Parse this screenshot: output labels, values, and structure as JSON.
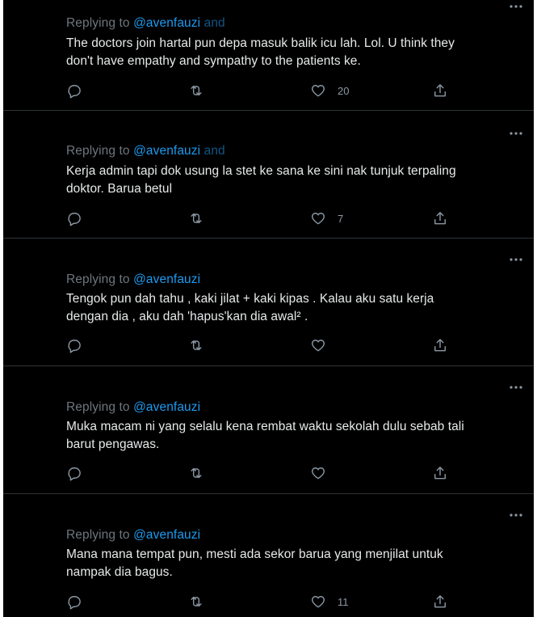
{
  "replying_prefix": "Replying to",
  "tweets": [
    {
      "reply_to": "@avenfauzi",
      "reply_to_suffix": "and",
      "text_lines": [
        "The doctors join hartal pun depa masuk balik icu lah. Lol. U think they",
        "don't have empathy and sympathy to the patients ke."
      ],
      "likes": "20"
    },
    {
      "reply_to": "@avenfauzi",
      "reply_to_suffix": "and",
      "text_lines": [
        "Kerja admin tapi dok usung la stet ke sana ke sini nak tunjuk terpaling",
        "doktor. Barua betul"
      ],
      "likes": "7"
    },
    {
      "reply_to": "@avenfauzi",
      "reply_to_suffix": "",
      "text_lines": [
        "Tengok pun dah tahu , kaki jilat + kaki kipas . Kalau aku satu kerja",
        "dengan dia , aku dah 'hapus'kan dia awal² ."
      ],
      "likes": ""
    },
    {
      "reply_to": "@avenfauzi",
      "reply_to_suffix": "",
      "text_lines": [
        "Muka macam ni yang selalu kena rembat waktu sekolah dulu sebab tali",
        "barut pengawas."
      ],
      "likes": ""
    },
    {
      "reply_to": "@avenfauzi",
      "reply_to_suffix": "",
      "text_lines": [
        "Mana mana tempat pun, mesti ada sekor barua yang menjilat untuk",
        "nampak dia bagus."
      ],
      "likes": "11"
    }
  ],
  "icons": {
    "more": "more-horizontal-icon",
    "reply": "reply-bubble-icon",
    "retweet": "retweet-icon",
    "like": "heart-icon",
    "share": "share-upload-icon"
  },
  "colors": {
    "background": "#000000",
    "text": "#e7e9ea",
    "muted": "#6e767d",
    "link": "#1d9bf0",
    "divider": "#2f3336"
  }
}
